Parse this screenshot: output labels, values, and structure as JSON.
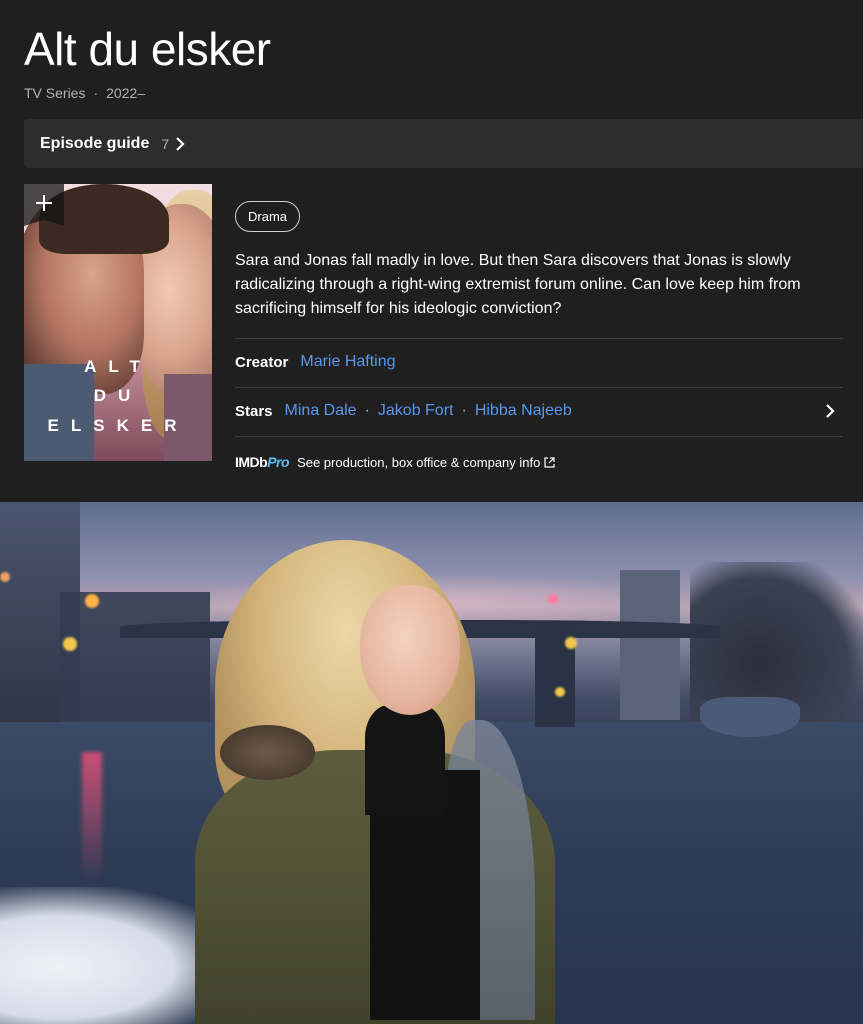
{
  "title": "Alt du elsker",
  "meta": {
    "type": "TV Series",
    "years": "2022–"
  },
  "episode_guide": {
    "label": "Episode guide",
    "count": "7"
  },
  "poster": {
    "title_line1": "ALT",
    "title_line2": "DU",
    "title_line3": "ELSKER"
  },
  "genre": "Drama",
  "plot": "Sara and Jonas fall madly in love. But then Sara discovers that Jonas is slowly radicalizing through a right-wing extremist forum online. Can love keep him from sacrificing himself for his ideologic conviction?",
  "creator": {
    "label": "Creator",
    "name": "Marie Hafting"
  },
  "stars": {
    "label": "Stars",
    "names": [
      "Mina Dale",
      "Jakob Fort",
      "Hibba Najeeb"
    ]
  },
  "imdbpro": {
    "logo_imdb": "IMDb",
    "logo_pro": "Pro",
    "text": "See production, box office & company info"
  },
  "colors": {
    "background": "#1f1f1f",
    "link": "#5799ef",
    "pro_accent": "#5dbcf5"
  }
}
